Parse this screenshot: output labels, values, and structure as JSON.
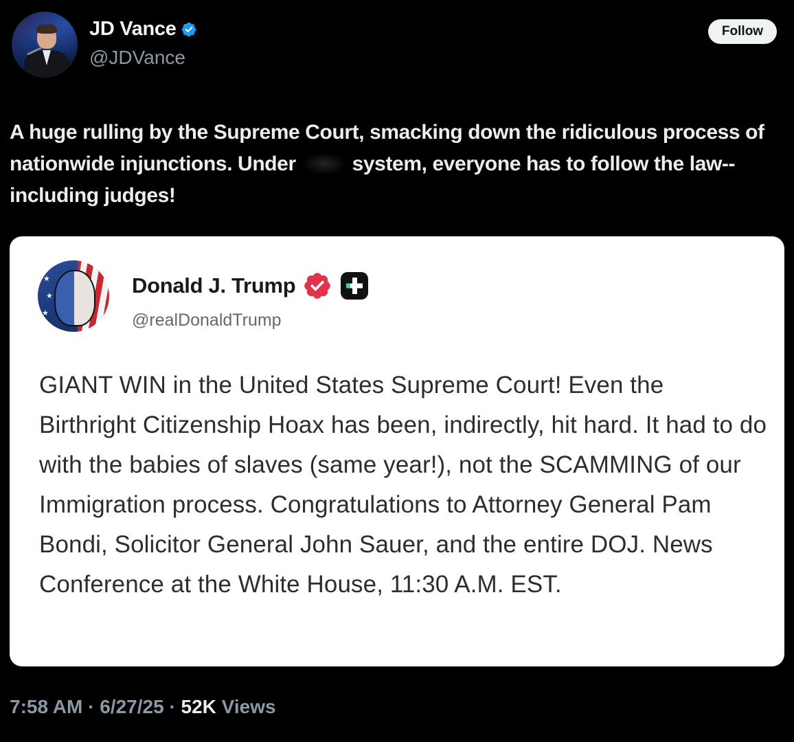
{
  "author": {
    "name": "JD Vance",
    "handle": "@JDVance",
    "verified_icon": "verified-badge-icon"
  },
  "follow_label": "Follow",
  "post": {
    "text_before": "A huge rulling by the Supreme Court, smacking down the ridiculous process of nationwide injunctions. Under ",
    "text_after": " system, everyone has to follow the law--including judges!"
  },
  "quoted": {
    "name": "Donald J. Trump",
    "handle": "@realDonaldTrump",
    "text": "GIANT WIN in the United States Supreme Court! Even the Birthright Citizenship Hoax has been, indirectly, hit hard. It had to do with the babies of slaves (same year!), not the SCAMMING of our Immigration process. Congratulations to Attorney General Pam Bondi, Solicitor General John Sauer, and the entire DOJ. News Conference at the White House, 11:30 A.M. EST."
  },
  "meta": {
    "time": "7:58 AM",
    "sep1": " · ",
    "date": "6/27/25",
    "sep2": " · ",
    "views_count": "52K",
    "views_label": " Views"
  },
  "colors": {
    "background": "#000000",
    "verified_blue": "#1d9bf0",
    "truth_verified_red": "#e0344b",
    "card_bg": "#ffffff"
  }
}
